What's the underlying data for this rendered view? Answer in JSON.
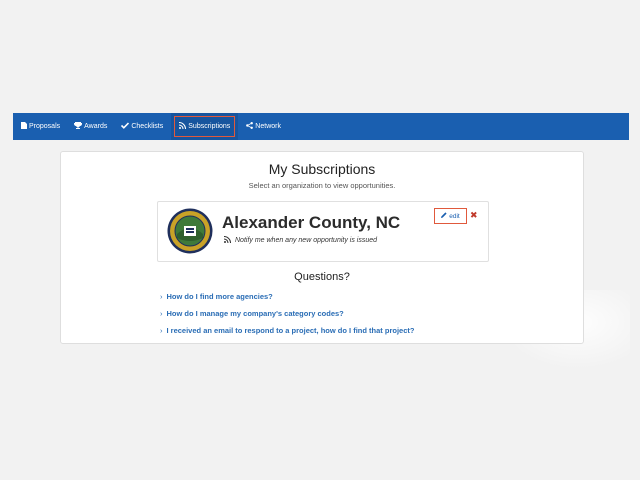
{
  "nav": {
    "items": [
      {
        "label": "Proposals",
        "icon": "file-icon"
      },
      {
        "label": "Awards",
        "icon": "trophy-icon"
      },
      {
        "label": "Checklists",
        "icon": "check-icon"
      },
      {
        "label": "Subscriptions",
        "icon": "rss-icon",
        "active": true
      },
      {
        "label": "Network",
        "icon": "share-icon"
      }
    ],
    "background": "#1a5fb0",
    "highlight": "#e0593c"
  },
  "main": {
    "title": "My Subscriptions",
    "subtitle": "Select an organization to view opportunities."
  },
  "subscription": {
    "org_name": "Alexander County, NC",
    "notify_text": "Notify me when any new opportunity is issued",
    "edit_label": "edit",
    "delete_symbol": "✖"
  },
  "questions": {
    "title": "Questions?",
    "items": [
      "How do I find more agencies?",
      "How do I manage my company's category codes?",
      "I received an email to respond to a project, how do I find that project?"
    ]
  },
  "colors": {
    "link": "#2a6db5",
    "delete": "#c0392b"
  }
}
